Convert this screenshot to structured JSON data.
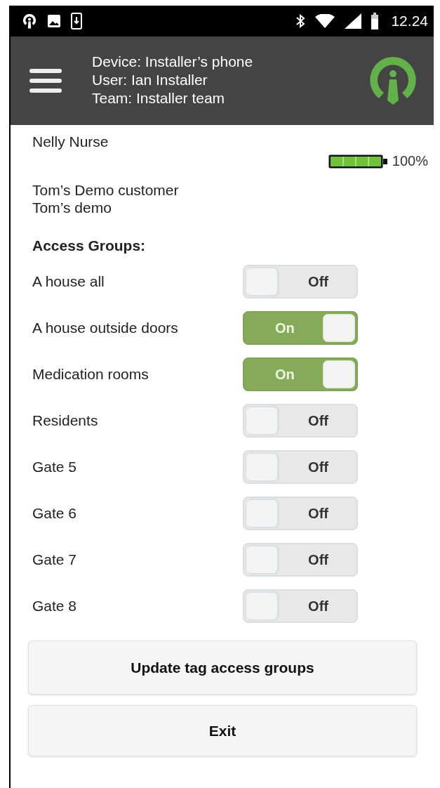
{
  "status_bar": {
    "time": "12.24"
  },
  "header": {
    "lines": [
      "Device: Installer’s phone",
      "User: Ian Installer",
      "Team: Installer team"
    ]
  },
  "person": {
    "name": "Nelly Nurse",
    "battery_reading": "100%"
  },
  "customer": {
    "lines": [
      "Tom’s Demo customer",
      "Tom’s demo"
    ]
  },
  "access_groups": {
    "title": "Access Groups:",
    "items": [
      {
        "label": "A house all",
        "on": false,
        "state_label": "Off"
      },
      {
        "label": "A house outside doors",
        "on": true,
        "state_label": "On"
      },
      {
        "label": "Medication rooms",
        "on": true,
        "state_label": "On"
      },
      {
        "label": "Residents",
        "on": false,
        "state_label": "Off"
      },
      {
        "label": "Gate 5",
        "on": false,
        "state_label": "Off"
      },
      {
        "label": "Gate 6",
        "on": false,
        "state_label": "Off"
      },
      {
        "label": "Gate 7",
        "on": false,
        "state_label": "Off"
      },
      {
        "label": "Gate 8",
        "on": false,
        "state_label": "Off"
      }
    ]
  },
  "buttons": [
    "Update tag access groups",
    "Exit"
  ]
}
